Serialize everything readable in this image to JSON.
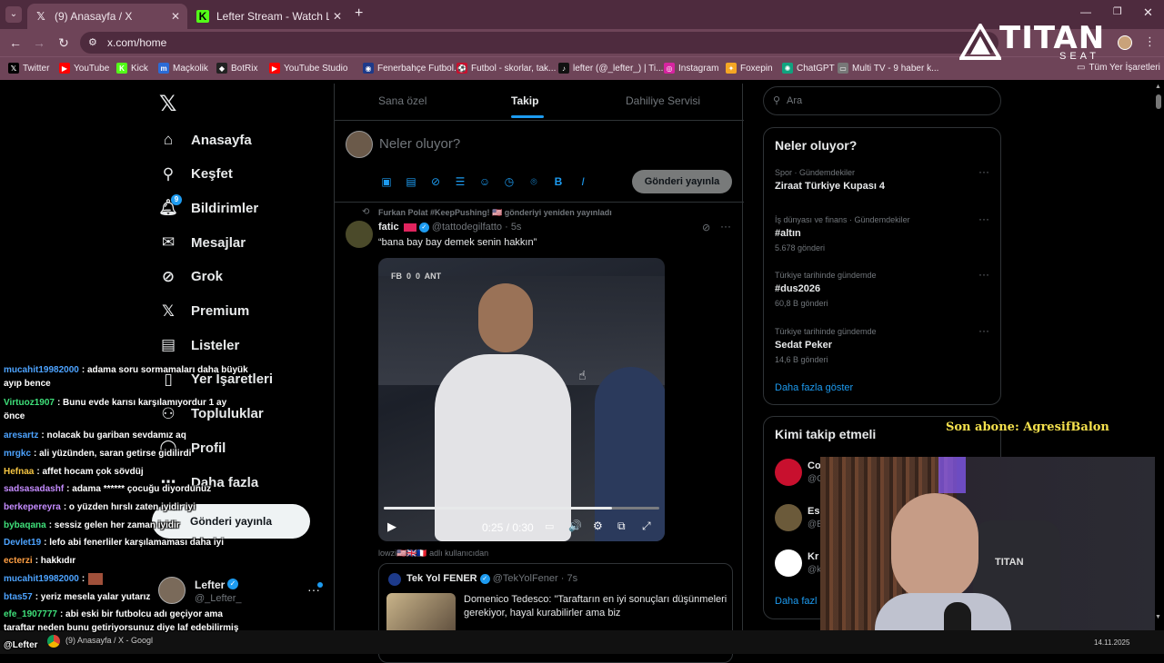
{
  "browser": {
    "tabs": [
      {
        "title": "(9) Anasayfa / X",
        "active": true
      },
      {
        "title": "Lefter Stream - Watch Live on K",
        "active": false
      }
    ],
    "new_tab": "+",
    "url": "x.com/home",
    "bookmarks": [
      {
        "label": "Twitter",
        "icon": "x-icon",
        "color": "#000000"
      },
      {
        "label": "YouTube",
        "icon": "youtube-icon",
        "color": "#ff0000"
      },
      {
        "label": "Kick",
        "icon": "kick-icon",
        "color": "#53fc18"
      },
      {
        "label": "Maçkolik",
        "icon": "mackolik-icon",
        "color": "#2b6bd6"
      },
      {
        "label": "BotRix",
        "icon": "botrix-icon",
        "color": "#222222"
      },
      {
        "label": "YouTube Studio",
        "icon": "youtube-studio-icon",
        "color": "#ff0000"
      },
      {
        "label": "Fenerbahçe Futbol...",
        "icon": "fenerbahce-icon",
        "color": "#1d3a8a"
      },
      {
        "label": "Futbol - skorlar, tak...",
        "icon": "flashscore-icon",
        "color": "#c8102e"
      },
      {
        "label": "lefter (@_lefter_) | Ti...",
        "icon": "tiktok-icon",
        "color": "#111111"
      },
      {
        "label": "Instagram",
        "icon": "instagram-icon",
        "color": "#d6249f"
      },
      {
        "label": "Foxepin",
        "icon": "foxepin-icon",
        "color": "#f5a623"
      },
      {
        "label": "ChatGPT",
        "icon": "chatgpt-icon",
        "color": "#10a37f"
      },
      {
        "label": "Multi TV - 9 haber k...",
        "icon": "multitv-icon",
        "color": "#777777"
      }
    ],
    "all_bookmarks": "Tüm Yer İşaretleri"
  },
  "overlay": {
    "brand": "TITAN",
    "brand_sub": "SEAT",
    "subscriber": "Son abone: AgresifBalon"
  },
  "nav": {
    "items": [
      {
        "label": "Anasayfa",
        "icon": "home-icon"
      },
      {
        "label": "Keşfet",
        "icon": "search-icon"
      },
      {
        "label": "Bildirimler",
        "icon": "bell-icon",
        "badge": "9"
      },
      {
        "label": "Mesajlar",
        "icon": "mail-icon"
      },
      {
        "label": "Grok",
        "icon": "grok-icon"
      },
      {
        "label": "Premium",
        "icon": "x-icon"
      },
      {
        "label": "Listeler",
        "icon": "list-icon"
      },
      {
        "label": "Yer İşaretleri",
        "icon": "bookmark-icon"
      },
      {
        "label": "Topluluklar",
        "icon": "people-icon"
      },
      {
        "label": "Profil",
        "icon": "person-icon"
      },
      {
        "label": "Daha fazla",
        "icon": "more-icon"
      }
    ],
    "post_button": "Gönderi yayınla",
    "profile": {
      "name": "Lefter",
      "handle": "@_Lefter_"
    }
  },
  "feed": {
    "tabs": [
      "Sana özel",
      "Takip",
      "Dahiliye Servisi"
    ],
    "active_tab": "Takip",
    "composer": {
      "placeholder": "Neler oluyor?",
      "post_button": "Gönderi yayınla"
    },
    "post": {
      "repost_by": "Furkan Polat #KeepPushing! 🇺🇸 gönderiyi yeniden yayınladı",
      "author": "fatic",
      "handle": "@tattodegilfatto",
      "time": "· 5s",
      "text": "“bana bay bay demek senin hakkın”",
      "video": {
        "scoreboard": "FB  0  0  ANT",
        "time": "0:25 / 0:30",
        "progress": 0.83
      },
      "by_line": "lowzi🇺🇸🇬🇧🇫🇷 adlı kullanıcıdan"
    },
    "quote": {
      "author": "Tek Yol FENER",
      "handle": "@TekYolFener",
      "time": "· 7s",
      "text": "Domenico Tedesco: \"Taraftarın en iyi sonuçları düşünmeleri gerekiyor, hayal kurabilirler ama biz"
    }
  },
  "right": {
    "search_placeholder": "Ara",
    "trends_title": "Neler oluyor?",
    "trends": [
      {
        "category": "Spor · Gündemdekiler",
        "name": "Ziraat Türkiye Kupası 4",
        "count": ""
      },
      {
        "category": "İş dünyası ve finans · Gündemdekiler",
        "name": "#altın",
        "count": "5.678 gönderi"
      },
      {
        "category": "Türkiye tarihinde gündemde",
        "name": "#dus2026",
        "count": "60,8 B gönderi"
      },
      {
        "category": "Türkiye tarihinde gündemde",
        "name": "Sedat Peker",
        "count": "14,6 B gönderi"
      }
    ],
    "show_more": "Daha fazla göster",
    "who_to_follow": "Kimi takip etmeli",
    "follow": [
      {
        "name": "Cor",
        "handle": "@C"
      },
      {
        "name": "Esi",
        "handle": "@E"
      },
      {
        "name": "Kr",
        "handle": "@k"
      }
    ],
    "follow_more": "Daha fazl"
  },
  "chat": [
    {
      "user": "mucahit19982000",
      "color": "#4da3ff",
      "msg": ": adama soru sormamaları daha büyük ayıp bence"
    },
    {
      "user": "Virtuoz1907",
      "color": "#3fe07a",
      "msg": ": Bunu evde karısı karşılamıyordur 1 ay önce"
    },
    {
      "user": "aresartz",
      "color": "#4da3ff",
      "msg": ": nolacak bu gariban sevdamız aq"
    },
    {
      "user": "mrgkc",
      "color": "#4da3ff",
      "msg": ": ali yüzünden, saran getirse gidilirdi"
    },
    {
      "user": "Hefnaa",
      "color": "#f5c542",
      "msg": ": affet hocam çok sövdüj"
    },
    {
      "user": "sadsasadashf",
      "color": "#c58cff",
      "msg": ": adama ****** çocuğu diyordunuz"
    },
    {
      "user": "berkepereyra",
      "color": "#c58cff",
      "msg": ": o yüzden hırslı zaten iyidir iyi"
    },
    {
      "user": "bybaqana",
      "color": "#3fe07a",
      "msg": ": sessiz gelen her zaman iyidir"
    },
    {
      "user": "Devlet19",
      "color": "#4da3ff",
      "msg": ": lefo abi fenerliler karşılamaması daha iyi"
    },
    {
      "user": "ecterzi",
      "color": "#ff9f43",
      "msg": ": hakkıdır"
    },
    {
      "user": "mucahit19982000",
      "color": "#4da3ff",
      "msg": ":"
    },
    {
      "user": "btas57",
      "color": "#4da3ff",
      "msg": ": yeriz mesela yalar yutarız"
    },
    {
      "user": "efe_1907777",
      "color": "#3fe07a",
      "msg": ": abi eski bir futbolcu adı geçiyor ama taraftar neden bunu getiriyorsunuz diye laf edebilirmiş"
    },
    {
      "user": "@Lefter",
      "color": "#ffffff",
      "msg": ""
    }
  ],
  "taskbar": {
    "app": "(9) Anasayfa / X - Googl",
    "date": "14.11.2025"
  }
}
